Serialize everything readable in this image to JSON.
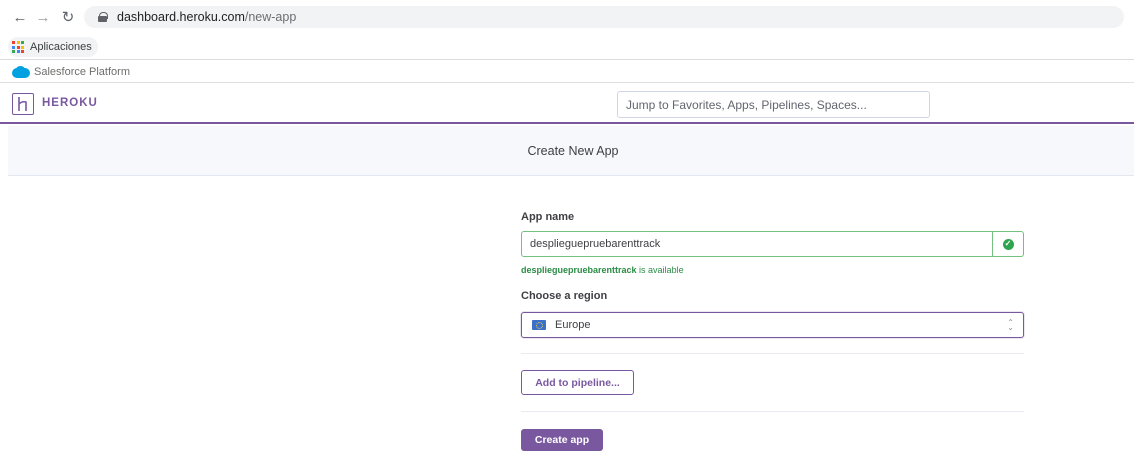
{
  "browser": {
    "url_host": "dashboard.heroku.com",
    "url_path": "/new-app",
    "bookmark_apps_label": "Aplicaciones"
  },
  "salesforce_bar": {
    "label": "Salesforce Platform"
  },
  "header": {
    "brand": "HEROKU",
    "search_placeholder": "Jump to Favorites, Apps, Pipelines, Spaces..."
  },
  "subheader": {
    "title": "Create New App"
  },
  "form": {
    "app_name_label": "App name",
    "app_name_value": "desplieguepruebarenttrack",
    "availability_name": "desplieguepruebarenttrack",
    "availability_suffix": " is available",
    "region_label": "Choose a region",
    "region_value": "Europe",
    "pipeline_button": "Add to pipeline...",
    "create_button": "Create app"
  },
  "icons": {
    "back": "arrow-left-icon",
    "forward": "arrow-right-icon",
    "reload": "reload-icon",
    "lock": "lock-icon",
    "apps": "apps-grid-icon",
    "salesforce": "salesforce-cloud-icon",
    "heroku": "heroku-logo-icon",
    "check": "check-circle-icon",
    "flag": "eu-flag-icon",
    "chevron": "chevron-updown-icon"
  },
  "colors": {
    "heroku_purple": "#79589f",
    "success_green": "#2fa44e",
    "salesforce_blue": "#00a1e0"
  }
}
